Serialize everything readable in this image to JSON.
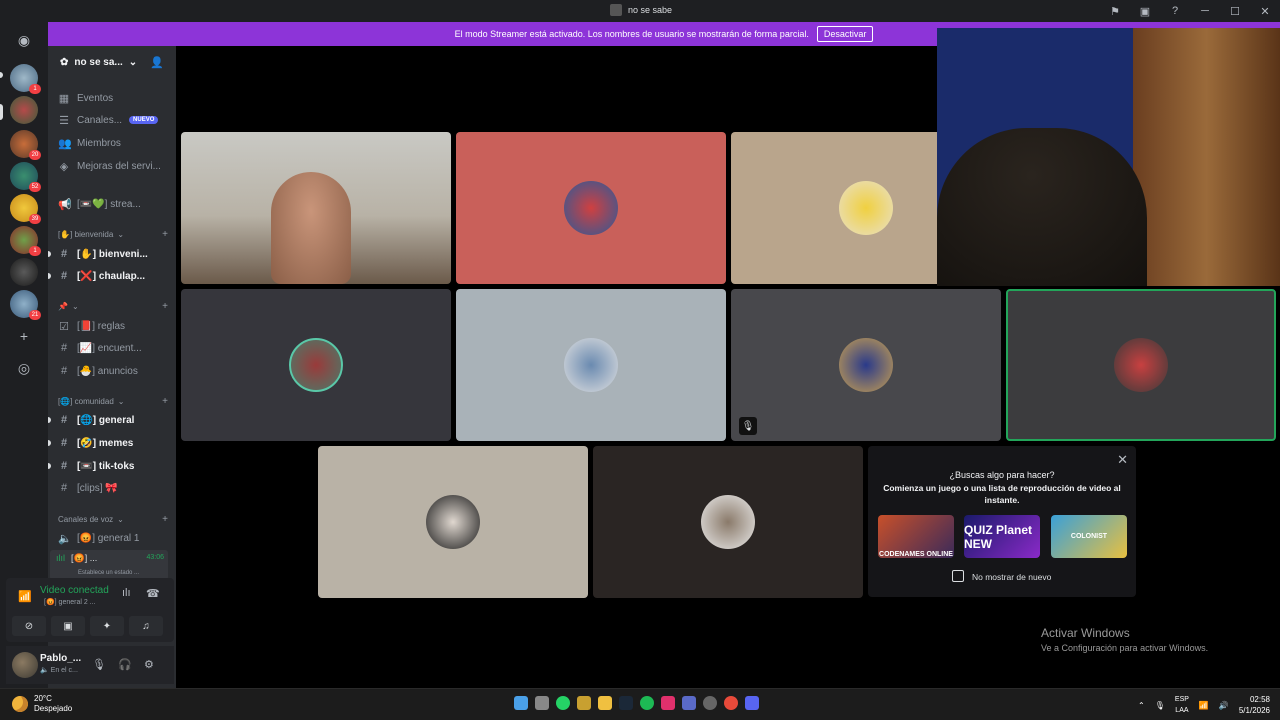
{
  "titlebar": {
    "title": "no se sabe",
    "icons": [
      "inbox-icon",
      "screen-share-icon",
      "help-icon",
      "minimize-icon",
      "maximize-icon",
      "close-icon"
    ]
  },
  "banner": {
    "text": "El modo Streamer está activado. Los nombres de usuario se mostrarán de forma parcial.",
    "button": "Desactivar",
    "color": "#8d34d8"
  },
  "rail": {
    "servers": [
      {
        "badge": "1"
      },
      {
        "badge": ""
      },
      {
        "badge": "20"
      },
      {
        "badge": "52"
      },
      {
        "badge": "39"
      },
      {
        "badge": "1"
      },
      {
        "badge": ""
      },
      {
        "badge": "21"
      }
    ]
  },
  "sidebar": {
    "server_name": "no se sa...",
    "eventos": "Eventos",
    "canales": "Canales...",
    "nuevo_badge": "NUEVO",
    "miembros": "Miembros",
    "mejoras": "Mejoras del servi...",
    "stream_channel": "[📼💚] strea...",
    "cat_bienvenida": "[✋] bienvenida",
    "bienvenida": "[✋] bienveni...",
    "chaulap": "[❌] chaulap...",
    "cat_pin": "📌",
    "reglas": "[📕] reglas",
    "encuentros": "[📈] encuent...",
    "anuncios": "[🐣] anuncios",
    "cat_comunidad": "[🌐] comunidad",
    "general": "[🌐] general",
    "memes": "[🤣] memes",
    "tiktoks": "[📼] tik-toks",
    "clips": "[clips] 🎀",
    "cat_voz": "Canales de voz",
    "voice_general": "[😡] general 1",
    "voice_active": "[😡] ...",
    "voice_time": "43:06",
    "voice_status": "Establece un estado ..."
  },
  "voice_panel": {
    "title": "Video conectad",
    "subtitle": "[😡] general 2 ..."
  },
  "user_panel": {
    "name": "Pablo_...",
    "status": "🔈 En el c..."
  },
  "suggest": {
    "q1": "¿Buscas algo para hacer?",
    "q2": "Comienza un juego o una lista de reproducción de video al instante.",
    "games": [
      "CODENAMES ONLINE",
      "QUIZ Planet NEW",
      "COLONIST"
    ],
    "checkbox": "No mostrar de nuevo"
  },
  "watermark": {
    "line1": "Activar Windows",
    "line2": "Ve a Configuración para activar Windows."
  },
  "taskbar": {
    "temp": "20°C",
    "weather": "Despejado",
    "lang1": "ESP",
    "lang2": "LAA",
    "time": "02:58",
    "date": "5/1/2026"
  }
}
